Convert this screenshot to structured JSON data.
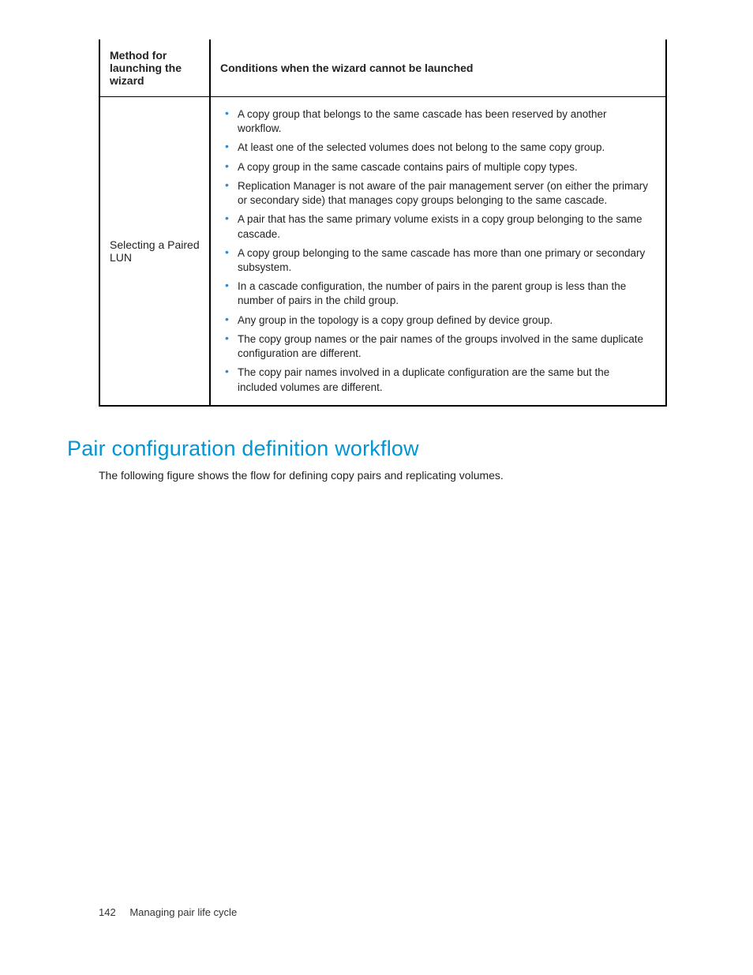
{
  "table": {
    "headers": {
      "method": "Method for launching the wizard",
      "conditions": "Conditions when the wizard cannot be launched"
    },
    "row": {
      "method": "Selecting a Paired LUN",
      "conditions": [
        "A copy group that belongs to the same cascade has been reserved by another workflow.",
        "At least one of the selected volumes does not belong to the same copy group.",
        "A copy group in the same cascade contains pairs of multiple copy types.",
        "Replication Manager is not aware of the pair management server (on either the primary or secondary side) that manages copy groups belonging to the same cascade.",
        "A pair that has the same primary volume exists in a copy group belonging to the same cascade.",
        "A copy group belonging to the same cascade has more than one primary or secondary subsystem.",
        "In a cascade configuration, the number of pairs in the parent group is less than the number of pairs in the child group.",
        "Any group in the topology is a copy group defined by device group.",
        "The copy group names or the pair names of the groups involved in the same duplicate configuration are different.",
        "The copy pair names involved in a duplicate configuration are the same but the included volumes are different."
      ]
    }
  },
  "section": {
    "heading": "Pair configuration definition workflow",
    "intro": "The following figure shows the flow for defining copy pairs and replicating volumes."
  },
  "footer": {
    "page_number": "142",
    "chapter": "Managing pair life cycle"
  }
}
